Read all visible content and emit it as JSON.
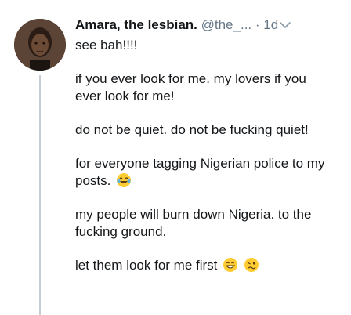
{
  "tweet": {
    "author_name": "Amara, the lesbian.",
    "handle": "@the_...",
    "separator": "·",
    "timestamp": "1d",
    "icons": {
      "avatar": "user-avatar",
      "menu": "chevron-down-icon",
      "emoji_laugh": "face-with-tears-of-joy-emoji",
      "emoji_grin": "grinning-face-emoji",
      "emoji_dizzy": "woozy-face-emoji"
    },
    "lines": [
      {
        "text": "see bah!!!!"
      },
      {
        "text": "if you ever look for me. my lovers if you ever look for me!"
      },
      {
        "text": "do not be quiet. do not be fucking quiet!"
      },
      {
        "text": "for everyone tagging Nigerian police to my posts."
      },
      {
        "text": "my people will burn down Nigeria. to the fucking ground."
      },
      {
        "text": "let them look for me first"
      }
    ]
  },
  "colors": {
    "text": "#14171a",
    "secondary": "#657786",
    "thread_line": "#c4ced6",
    "emoji_yellow": "#ffcc33"
  }
}
